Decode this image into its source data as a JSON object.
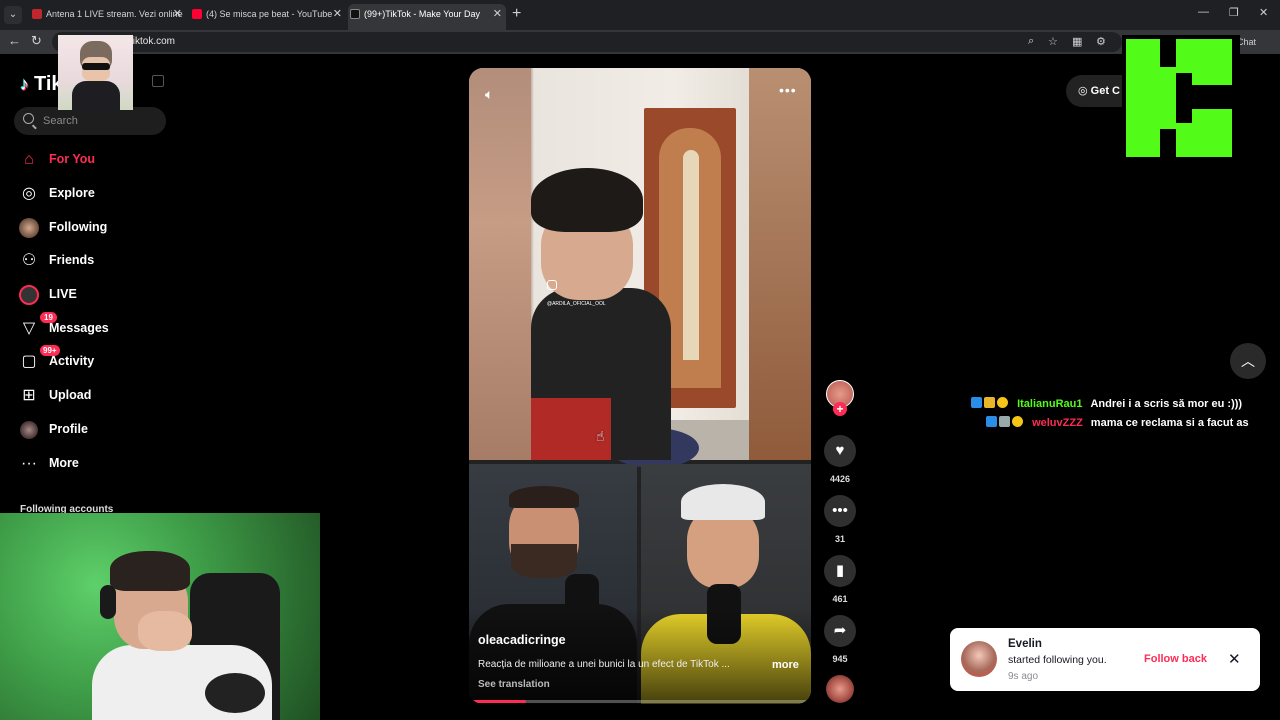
{
  "browser": {
    "tabs": [
      {
        "title": "Antena 1 LIVE stream. Vezi online",
        "active": false,
        "fav_color": "#c0262d"
      },
      {
        "title": "(4) Se misca pe beat - YouTube",
        "active": false,
        "fav_color": "#ff0033"
      },
      {
        "title": "(99+)TikTok - Make Your Day",
        "active": true,
        "fav_color": "#111111"
      }
    ],
    "url": "tiktok.com",
    "chat_label": "Chat"
  },
  "sidebar": {
    "logo": "TikTok",
    "search_placeholder": "Search",
    "nav": [
      {
        "label": "For You",
        "icon": "home-icon",
        "active": true
      },
      {
        "label": "Explore",
        "icon": "compass-icon",
        "active": false
      },
      {
        "label": "Following",
        "icon": "following-avatar-icon",
        "active": false
      },
      {
        "label": "Friends",
        "icon": "friends-icon",
        "active": false
      },
      {
        "label": "LIVE",
        "icon": "live-icon",
        "active": false
      },
      {
        "label": "Messages",
        "icon": "messages-icon",
        "active": false,
        "badge": "19"
      },
      {
        "label": "Activity",
        "icon": "activity-icon",
        "active": false,
        "badge": "99+"
      },
      {
        "label": "Upload",
        "icon": "upload-icon",
        "active": false
      },
      {
        "label": "Profile",
        "icon": "profile-avatar-icon",
        "active": false
      },
      {
        "label": "More",
        "icon": "more-icon",
        "active": false
      }
    ],
    "following_header": "Following accounts"
  },
  "video": {
    "author": "oleacadicringe",
    "description": "Reacția de milioane a unei bunici la un efect de TikTok ...",
    "more_label": "more",
    "see_translation": "See translation",
    "watermark": "@ARDILA_OFICIAL_OOL",
    "progress": 0.16
  },
  "actions": {
    "likes": "4426",
    "comments": "31",
    "saves": "461",
    "shares": "945"
  },
  "top_right": {
    "get_coins": "Get C"
  },
  "chat": [
    {
      "user": "ItalianuRau1",
      "user_color": "#53fc18",
      "message": "Andrei i a scris să mor eu :)))"
    },
    {
      "user": "weluvZZZ",
      "user_color": "#fe2c55",
      "message": "mama ce reclama si a facut as"
    }
  ],
  "toast": {
    "name": "Evelin",
    "message": "started following you.",
    "time": "9s ago",
    "follow_back": "Follow back"
  },
  "colors": {
    "accent": "#fe2c55",
    "kick_green": "#53fc18"
  }
}
